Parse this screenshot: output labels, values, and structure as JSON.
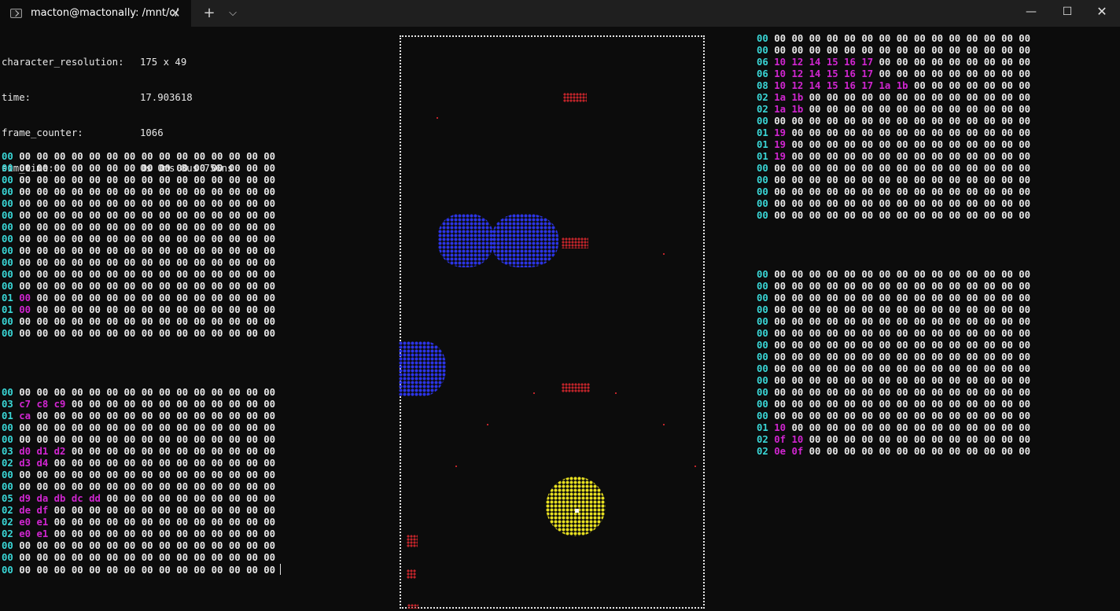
{
  "window": {
    "tab_title": "macton@mactonally: /mnt/c/",
    "tab_close": "✕",
    "new_tab": "+",
    "dropdown": "⌵",
    "minimize": "—",
    "maximize": "☐",
    "close": "✕"
  },
  "info": [
    {
      "key": "character_resolution:",
      "value": "175 x 49"
    },
    {
      "key": "time:",
      "value": "17.903618"
    },
    {
      "key": "frame_counter:",
      "value": "1066"
    },
    {
      "key": "sim_time:",
      "value": "0s 0ms 8us 756ns"
    }
  ],
  "colors": {
    "count": "#3ad7d7",
    "value": "#d126d1",
    "zero": "#e8e8e8",
    "blob_blue": "#2b34e6",
    "blob_red": "#c0242a",
    "blob_yellow": "#e7e021",
    "frame": "#e6e6e6"
  },
  "hex_tables": [
    {
      "rows": [
        [
          "00"
        ],
        [
          "00"
        ],
        [
          "00"
        ],
        [
          "00"
        ],
        [
          "00"
        ],
        [
          "00"
        ],
        [
          "00"
        ],
        [
          "00"
        ],
        [
          "00"
        ],
        [
          "00"
        ],
        [
          "00"
        ],
        [
          "00"
        ],
        [
          "01",
          "00"
        ],
        [
          "01",
          "00"
        ],
        [
          "00"
        ],
        [
          "00"
        ]
      ]
    },
    {
      "rows": [
        [
          "00"
        ],
        [
          "03",
          "c7",
          "c8",
          "c9"
        ],
        [
          "01",
          "ca"
        ],
        [
          "00"
        ],
        [
          "00"
        ],
        [
          "03",
          "d0",
          "d1",
          "d2"
        ],
        [
          "02",
          "d3",
          "d4"
        ],
        [
          "00"
        ],
        [
          "00"
        ],
        [
          "05",
          "d9",
          "da",
          "db",
          "dc",
          "dd"
        ],
        [
          "02",
          "de",
          "df"
        ],
        [
          "02",
          "e0",
          "e1"
        ],
        [
          "02",
          "e0",
          "e1"
        ],
        [
          "00"
        ],
        [
          "00"
        ],
        [
          "00"
        ]
      ]
    },
    {
      "rows": [
        [
          "00"
        ],
        [
          "00"
        ],
        [
          "06",
          "10",
          "12",
          "14",
          "15",
          "16",
          "17"
        ],
        [
          "06",
          "10",
          "12",
          "14",
          "15",
          "16",
          "17"
        ],
        [
          "08",
          "10",
          "12",
          "14",
          "15",
          "16",
          "17",
          "1a",
          "1b"
        ],
        [
          "02",
          "1a",
          "1b"
        ],
        [
          "02",
          "1a",
          "1b"
        ],
        [
          "00"
        ],
        [
          "01",
          "19"
        ],
        [
          "01",
          "19"
        ],
        [
          "01",
          "19"
        ],
        [
          "00"
        ],
        [
          "00"
        ],
        [
          "00"
        ],
        [
          "00"
        ],
        [
          "00"
        ]
      ]
    },
    {
      "rows": [
        [
          "00"
        ],
        [
          "00"
        ],
        [
          "00"
        ],
        [
          "00"
        ],
        [
          "00"
        ],
        [
          "00"
        ],
        [
          "00"
        ],
        [
          "00"
        ],
        [
          "00"
        ],
        [
          "00"
        ],
        [
          "00"
        ],
        [
          "00"
        ],
        [
          "00"
        ],
        [
          "01",
          "10"
        ],
        [
          "02",
          "0f",
          "10"
        ],
        [
          "02",
          "0e",
          "0f"
        ]
      ]
    }
  ],
  "row_width": 16
}
